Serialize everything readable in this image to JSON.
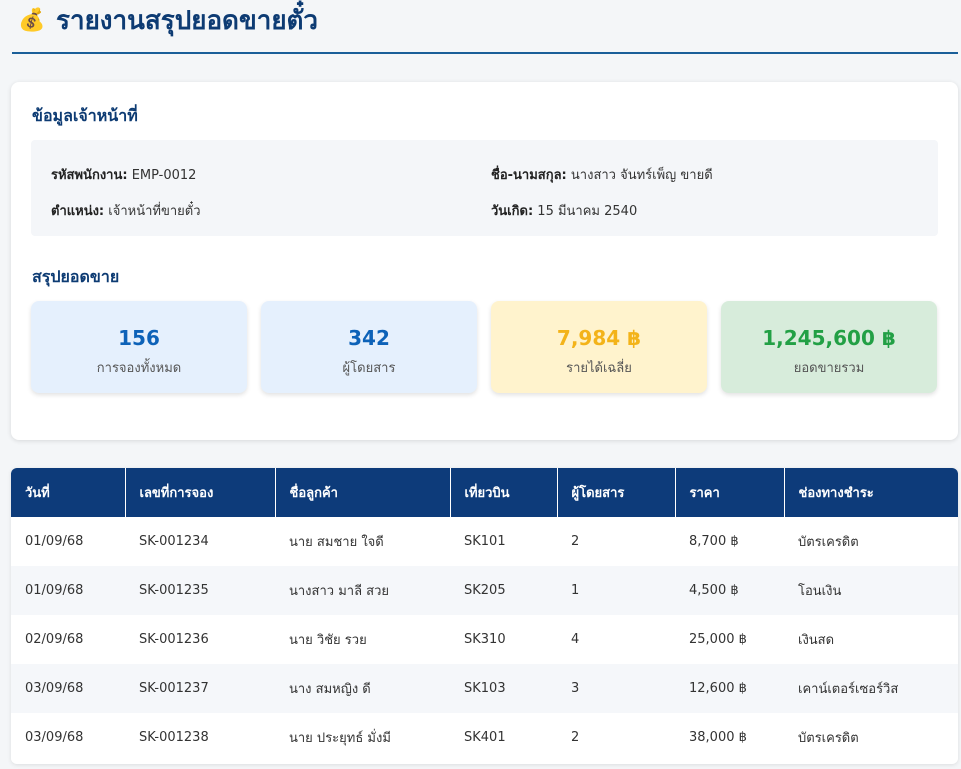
{
  "header": {
    "icon": "money-bag-icon",
    "icon_glyph": "💰",
    "title": "รายงานสรุปยอดขายตั๋ว"
  },
  "employee": {
    "section_title": "ข้อมูลเจ้าหน้าที่",
    "fields": [
      {
        "label": "รหัสพนักงาน:",
        "value": "EMP-0012"
      },
      {
        "label": "ชื่อ-นามสกุล:",
        "value": "นางสาว จันทร์เพ็ญ ขายดี"
      },
      {
        "label": "ตำแหน่ง:",
        "value": "เจ้าหน้าที่ขายตั๋ว"
      },
      {
        "label": "วันเกิด:",
        "value": "15 มีนาคม 2540"
      }
    ]
  },
  "summary": {
    "section_title": "สรุปยอดขาย",
    "stats": [
      {
        "value": "156",
        "label": "การจองทั้งหมด",
        "color": "#0d62b8"
      },
      {
        "value": "342",
        "label": "ผู้โดยสาร",
        "color": "#0d62b8"
      },
      {
        "value": "7,984 ฿",
        "label": "รายได้เฉลี่ย",
        "color": "#f3b319"
      },
      {
        "value": "1,245,600 ฿",
        "label": "ยอดขายรวม",
        "color": "#22a045"
      }
    ]
  },
  "table": {
    "headers": [
      "วันที่",
      "เลขที่การจอง",
      "ชื่อลูกค้า",
      "เที่ยวบิน",
      "ผู้โดยสาร",
      "ราคา",
      "ช่องทางชำระ"
    ],
    "rows": [
      [
        "01/09/68",
        "SK-001234",
        "นาย สมชาย ใจดี",
        "SK101",
        "2",
        "8,700 ฿",
        "บัตรเครดิต"
      ],
      [
        "01/09/68",
        "SK-001235",
        "นางสาว มาลี สวย",
        "SK205",
        "1",
        "4,500 ฿",
        "โอนเงิน"
      ],
      [
        "02/09/68",
        "SK-001236",
        "นาย วิชัย รวย",
        "SK310",
        "4",
        "25,000 ฿",
        "เงินสด"
      ],
      [
        "03/09/68",
        "SK-001237",
        "นาง สมหญิง ดี",
        "SK103",
        "3",
        "12,600 ฿",
        "เคาน์เตอร์เซอร์วิส"
      ],
      [
        "03/09/68",
        "SK-001238",
        "นาย ประยุทธ์ มั่งมี",
        "SK401",
        "2",
        "38,000 ฿",
        "บัตรเครดิต"
      ]
    ],
    "header_color": "#0d3b7a"
  }
}
